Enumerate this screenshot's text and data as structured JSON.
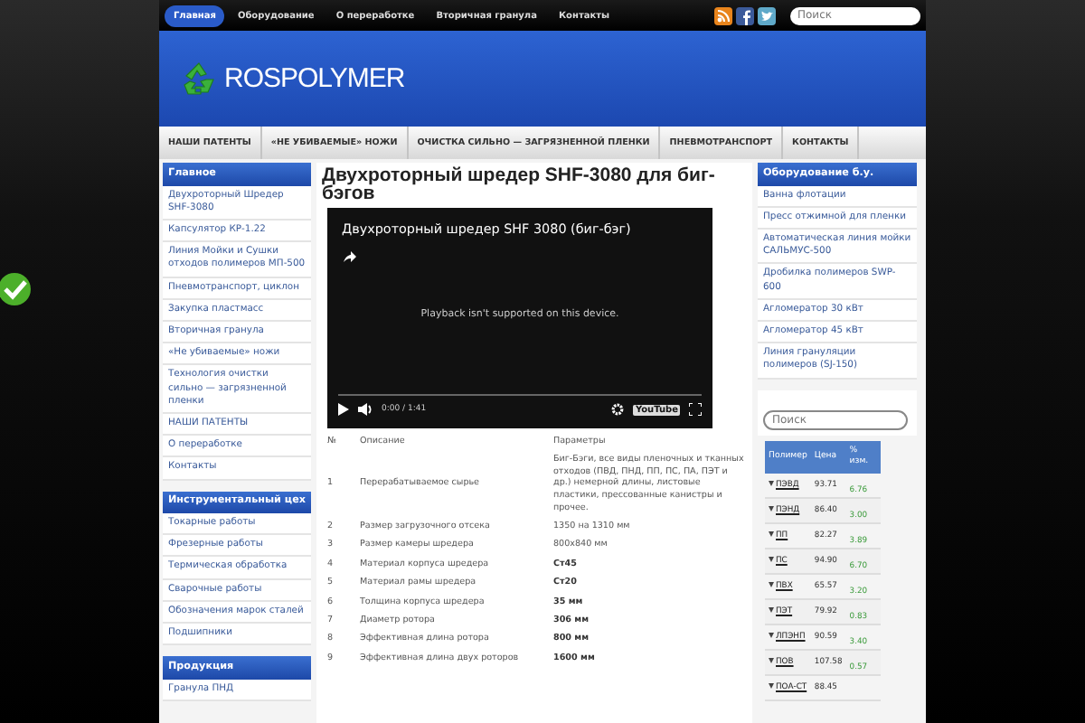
{
  "topbar": {
    "nav": [
      {
        "label": "Главная",
        "selected": true
      },
      {
        "label": "Оборудование",
        "selected": false
      },
      {
        "label": "О переработке",
        "selected": false
      },
      {
        "label": "Вторичная гранула",
        "selected": false
      },
      {
        "label": "Контакты",
        "selected": false
      }
    ],
    "search": {
      "placeholder": "Поиск"
    }
  },
  "header": {
    "logo": "ROSPOLYMER"
  },
  "menu": [
    "НАШИ ПАТЕНТЫ",
    "«НЕ УБИВАЕМЫЕ» НОЖИ",
    "ОЧИСТКА СИЛЬНО — ЗАГРЯЗНЕННОЙ ПЛЕНКИ",
    "ПНЕВМОТРАНСПОРТ",
    "КОНТАКТЫ"
  ],
  "left_sidebar": [
    {
      "title": "Главное",
      "items": [
        "Двухроторный Шредер SHF-3080",
        "Капсулятор КР-1.22",
        "Линия Мойки и Сушки отходов полимеров МП-500",
        "Пневмотранспорт, циклон",
        "Закупка пластмасс",
        "Вторичная гранула",
        "«Не убиваемые» ножи",
        "Технология очистки сильно — загрязненной пленки",
        "НАШИ ПАТЕНТЫ",
        "О переработке",
        "Контакты"
      ]
    },
    {
      "title": "Инструментальный цех",
      "items": [
        "Токарные работы",
        "Фрезерные работы",
        "Термическая обработка",
        "Сварочные работы",
        "Обозначения марок сталей",
        "Подшипники"
      ]
    },
    {
      "title": "Продукция",
      "items": [
        "Гранула ПНД"
      ]
    }
  ],
  "article": {
    "title": "Двухроторный шредер SHF-3080 для биг-бэгов",
    "video": {
      "title": "Двухроторный шредер SHF 3080 (биг-бэг)",
      "level": 0,
      "message": "Playback isn't supported on this device.",
      "time": "0:00 / 1:41",
      "brand": "YouTube"
    },
    "table": {
      "columns": [
        "№",
        "Описание",
        "Параметры"
      ],
      "rows": [
        {
          "n": "1",
          "desc": "Перерабатываемое сырье",
          "value": "Биг-Бэги, все виды пленочных и тканных отходов (ПВД, ПНД, ПП, ПС, ПА, ПЭТ и др.) немерной длины, листовые пластики, прессованные канистры и прочее.",
          "bold": false
        },
        {
          "n": "2",
          "desc": "Размер загрузочного отсека",
          "value": "1350 на 1310 мм",
          "bold": false
        },
        {
          "n": "3",
          "desc": "Размер камеры шредера",
          "value": "800x840 мм",
          "bold": false
        },
        {
          "n": "4",
          "desc": "Материал корпуса шредера",
          "value": "Ст45",
          "bold": true
        },
        {
          "n": "5",
          "desc": "Материал рамы шредера",
          "value": "Ст20",
          "bold": true
        },
        {
          "n": "6",
          "desc": "Толщина корпуса шредера",
          "value": "35 мм",
          "bold": true
        },
        {
          "n": "7",
          "desc": "Диаметр ротора",
          "value": "306 мм",
          "bold": true
        },
        {
          "n": "8",
          "desc": "Эффективная длина ротора",
          "value": "800 мм",
          "bold": true
        },
        {
          "n": "9",
          "desc": "Эффективная длина двух роторов",
          "value": "1600 мм",
          "bold": true
        }
      ]
    }
  },
  "right_sidebar": {
    "title": "Оборудование б.у.",
    "items": [
      "Ванна флотации",
      "Пресс отжимной для пленки",
      "Автоматическая линия мойки САЛЬМУС-500",
      "Дробилка полимеров SWP-600",
      "Агломератор 30 кВт",
      "Агломератор 45 кВт",
      "Линия грануляции полимеров (SJ-150)"
    ],
    "search": {
      "placeholder": "Поиск"
    },
    "prices": {
      "columns": [
        "Полимер",
        "Цена",
        "% изм."
      ],
      "rows": [
        {
          "name": "ПЭВД",
          "price": "93.71",
          "change": "6.76"
        },
        {
          "name": "ПЭНД",
          "price": "86.40",
          "change": "3.00"
        },
        {
          "name": "ПП",
          "price": "82.27",
          "change": "3.89"
        },
        {
          "name": "ПС",
          "price": "94.90",
          "change": "6.70"
        },
        {
          "name": "ПВХ",
          "price": "65.57",
          "change": "3.20"
        },
        {
          "name": "ПЭТ",
          "price": "79.92",
          "change": "0.83"
        },
        {
          "name": "ЛПЭНП",
          "price": "90.59",
          "change": "3.40"
        },
        {
          "name": "ПОВ",
          "price": "107.58",
          "change": "0.57"
        },
        {
          "name": "ПОА-СТ",
          "price": "88.45"
        }
      ]
    }
  }
}
